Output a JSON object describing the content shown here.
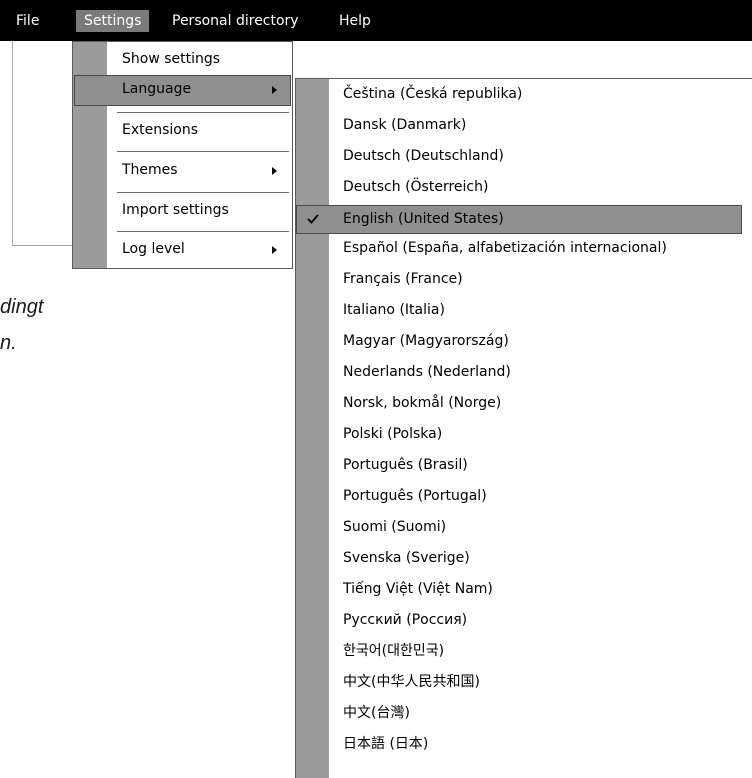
{
  "menubar": {
    "items": [
      {
        "label": "File"
      },
      {
        "label": "Settings"
      },
      {
        "label": "Personal directory"
      },
      {
        "label": "Help"
      }
    ]
  },
  "background": {
    "text_line1": "dingt",
    "text_line2": "n."
  },
  "settings_menu": {
    "items": [
      {
        "label": "Show settings",
        "has_submenu": false
      },
      {
        "label": "Language",
        "has_submenu": true
      },
      {
        "label": "Extensions",
        "has_submenu": false
      },
      {
        "label": "Themes",
        "has_submenu": true
      },
      {
        "label": "Import settings",
        "has_submenu": false
      },
      {
        "label": "Log level",
        "has_submenu": true
      }
    ]
  },
  "language_menu": {
    "selected": "English (United States)",
    "check_icon": "checkmark-icon",
    "items": [
      "Čeština (Česká republika)",
      "Dansk (Danmark)",
      "Deutsch (Deutschland)",
      "Deutsch (Österreich)",
      "English (United States)",
      "Español (España, alfabetización internacional)",
      "Français (France)",
      "Italiano (Italia)",
      "Magyar (Magyarország)",
      "Nederlands (Nederland)",
      "Norsk, bokmål (Norge)",
      "Polski (Polska)",
      "Português (Brasil)",
      "Português (Portugal)",
      "Suomi (Suomi)",
      "Svenska (Sverige)",
      "Tiếng Việt (Việt Nam)",
      "Русский (Россия)",
      "한국어(대한민국)",
      "中文(中华人民共和国)",
      "中文(台灣)",
      "日本語 (日本)"
    ]
  },
  "colors": {
    "menubar_bg": "#000000",
    "gutter": "#9b9b9b",
    "highlight": "#8f8f8f"
  }
}
